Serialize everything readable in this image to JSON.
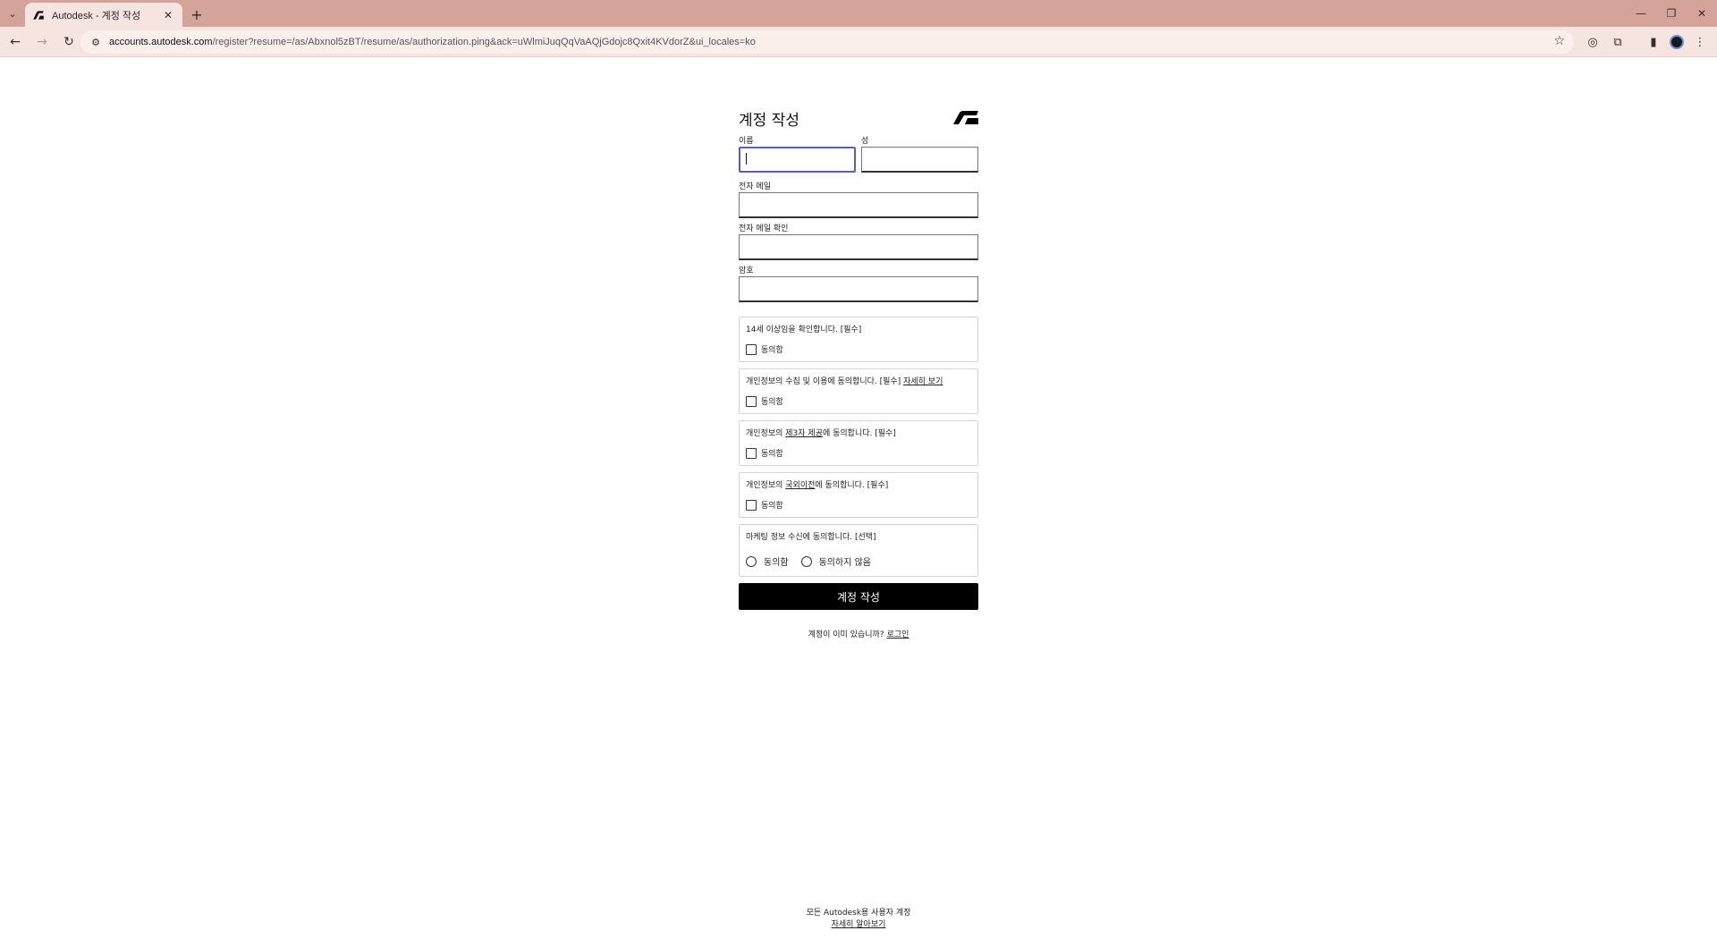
{
  "browser": {
    "tab_title": "Autodesk - 계정 작성",
    "url_host": "accounts.autodesk.com",
    "url_path": "/register?resume=/as/Abxnol5zBT/resume/as/authorization.ping&ack=uWlmiJuqQqVaAQjGdojc8Qxit4KVdorZ&ui_locales=ko"
  },
  "form": {
    "title": "계정 작성",
    "first_name_label": "이름",
    "last_name_label": "성",
    "email_label": "전자 메일",
    "email_confirm_label": "전자 메일 확인",
    "password_label": "암호"
  },
  "consents": [
    {
      "text": "14세 이상임을 확인합니다. [필수]",
      "check_label": "동의함"
    },
    {
      "text_before": "개인정보의 수집 및 이용에 동의합니다. [필수] ",
      "link": "자세히 보기",
      "check_label": "동의함"
    },
    {
      "text_before": "개인정보의 ",
      "link": "제3자 제공",
      "text_after": "에 동의합니다. [필수]",
      "check_label": "동의함"
    },
    {
      "text_before": "개인정보의 ",
      "link": "국외이전",
      "text_after": "에 동의합니다. [필수]",
      "check_label": "동의함"
    }
  ],
  "marketing": {
    "text": "마케팅 정보 수신에 동의합니다. [선택]",
    "agree_label": "동의함",
    "disagree_label": "동의하지 않음"
  },
  "submit_label": "계정 작성",
  "signin": {
    "prompt": "계정이 이미 있습니까?",
    "link": "로그인"
  },
  "footer": {
    "line1": "모든 Autodesk용 사용자 계정",
    "link": "자세히 알아보기"
  }
}
